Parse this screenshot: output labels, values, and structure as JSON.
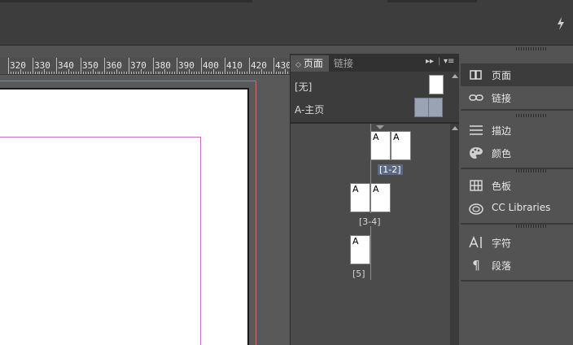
{
  "app": {
    "lightning_icon": "lightning-icon"
  },
  "ruler": {
    "labels": [
      "320",
      "330",
      "340",
      "350",
      "360",
      "370",
      "380",
      "390",
      "400",
      "410",
      "420",
      "430"
    ]
  },
  "pages_panel": {
    "tabs": [
      {
        "label": "页面",
        "active": true
      },
      {
        "label": "链接",
        "active": false
      }
    ],
    "masters": [
      {
        "label": "[无]"
      },
      {
        "label": "A-主页"
      }
    ],
    "spreads": [
      {
        "label": "[1-2]",
        "pages": [
          "A",
          "A"
        ],
        "selected": true
      },
      {
        "label": "[3-4]",
        "pages": [
          "A",
          "A"
        ],
        "selected": false
      },
      {
        "label": "[5]",
        "pages": [
          "A"
        ],
        "selected": false
      }
    ]
  },
  "dock": {
    "items": [
      {
        "icon": "pages-icon",
        "label": "页面"
      },
      {
        "icon": "links-icon",
        "label": "链接"
      },
      {
        "icon": "stroke-icon",
        "label": "描边"
      },
      {
        "icon": "color-icon",
        "label": "颜色"
      },
      {
        "icon": "swatches-icon",
        "label": "色板"
      },
      {
        "icon": "cc-libraries-icon",
        "label": "CC Libraries"
      },
      {
        "icon": "character-icon",
        "label": "字符"
      },
      {
        "icon": "paragraph-icon",
        "label": "段落"
      }
    ]
  },
  "colors": {
    "bleed": "#d46a6a",
    "margin": "#c670c6",
    "selected_label_bg": "#5a6a85"
  }
}
